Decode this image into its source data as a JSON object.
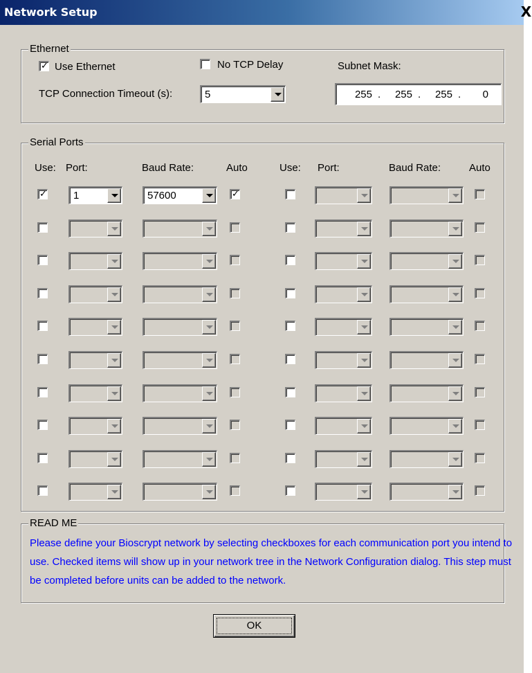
{
  "window": {
    "title": "Network Setup",
    "close_glyph": "X"
  },
  "ethernet": {
    "group_label": "Ethernet",
    "use_ethernet_label": "Use Ethernet",
    "use_ethernet_checked": true,
    "no_tcp_delay_label": "No TCP Delay",
    "no_tcp_delay_checked": false,
    "timeout_label": "TCP Connection Timeout (s):",
    "timeout_value": "5",
    "subnet_label": "Subnet Mask:",
    "subnet_octets": [
      "255",
      "255",
      "255",
      "0"
    ]
  },
  "serial_ports": {
    "group_label": "Serial Ports",
    "headers": {
      "use": "Use:",
      "port": "Port:",
      "baud": "Baud Rate:",
      "auto": "Auto"
    },
    "rows_left": [
      {
        "use": true,
        "port": "1",
        "baud": "57600",
        "auto": true,
        "enabled": true
      },
      {
        "use": false,
        "port": "",
        "baud": "",
        "auto": false,
        "enabled": false
      },
      {
        "use": false,
        "port": "",
        "baud": "",
        "auto": false,
        "enabled": false
      },
      {
        "use": false,
        "port": "",
        "baud": "",
        "auto": false,
        "enabled": false
      },
      {
        "use": false,
        "port": "",
        "baud": "",
        "auto": false,
        "enabled": false
      },
      {
        "use": false,
        "port": "",
        "baud": "",
        "auto": false,
        "enabled": false
      },
      {
        "use": false,
        "port": "",
        "baud": "",
        "auto": false,
        "enabled": false
      },
      {
        "use": false,
        "port": "",
        "baud": "",
        "auto": false,
        "enabled": false
      },
      {
        "use": false,
        "port": "",
        "baud": "",
        "auto": false,
        "enabled": false
      },
      {
        "use": false,
        "port": "",
        "baud": "",
        "auto": false,
        "enabled": false
      }
    ],
    "rows_right": [
      {
        "use": false,
        "port": "",
        "baud": "",
        "auto": false,
        "enabled": false
      },
      {
        "use": false,
        "port": "",
        "baud": "",
        "auto": false,
        "enabled": false
      },
      {
        "use": false,
        "port": "",
        "baud": "",
        "auto": false,
        "enabled": false
      },
      {
        "use": false,
        "port": "",
        "baud": "",
        "auto": false,
        "enabled": false
      },
      {
        "use": false,
        "port": "",
        "baud": "",
        "auto": false,
        "enabled": false
      },
      {
        "use": false,
        "port": "",
        "baud": "",
        "auto": false,
        "enabled": false
      },
      {
        "use": false,
        "port": "",
        "baud": "",
        "auto": false,
        "enabled": false
      },
      {
        "use": false,
        "port": "",
        "baud": "",
        "auto": false,
        "enabled": false
      },
      {
        "use": false,
        "port": "",
        "baud": "",
        "auto": false,
        "enabled": false
      },
      {
        "use": false,
        "port": "",
        "baud": "",
        "auto": false,
        "enabled": false
      }
    ]
  },
  "readme": {
    "group_label": "READ ME",
    "text": "Please define your Bioscrypt network by selecting checkboxes for each communication port you intend to use.  Checked items will show up in your network tree in the Network Configuration dialog.  This step must be completed before units can be added to the network."
  },
  "buttons": {
    "ok_label": "OK"
  },
  "colors": {
    "dialog_bg": "#d4d0c8",
    "title_gradient_start": "#0a246a",
    "title_gradient_end": "#a6caf0",
    "readme_text": "#0000ff"
  }
}
